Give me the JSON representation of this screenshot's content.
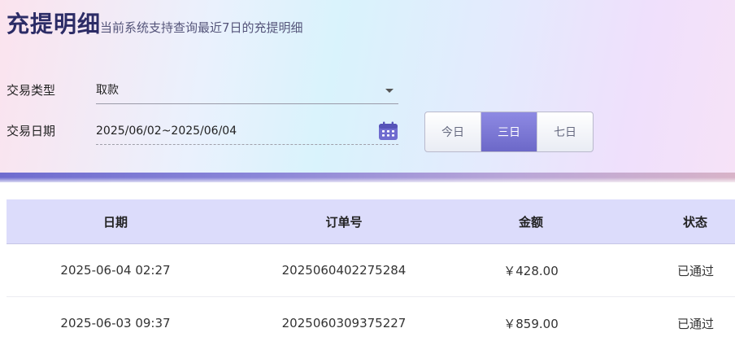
{
  "header": {
    "title": "充提明细",
    "subtitle": "当前系统支持查询最近7日的充提明细"
  },
  "filters": {
    "type_label": "交易类型",
    "type_value": "取款",
    "date_label": "交易日期",
    "date_value": "2025/06/02~2025/06/04",
    "ranges": [
      {
        "label": "今日",
        "active": false
      },
      {
        "label": "三日",
        "active": true
      },
      {
        "label": "七日",
        "active": false
      }
    ]
  },
  "table": {
    "headers": [
      "日期",
      "订单号",
      "金额",
      "状态"
    ],
    "rows": [
      {
        "date": "2025-06-04 02:27",
        "order": "2025060402275284",
        "amount": "￥428.00",
        "status": "已通过"
      },
      {
        "date": "2025-06-03 09:37",
        "order": "2025060309375227",
        "amount": "￥859.00",
        "status": "已通过"
      }
    ]
  },
  "colors": {
    "accent": "#6c68c8",
    "title": "#2c2c66",
    "table_header_bg": "#dcdcfb"
  },
  "icons": {
    "type_dropdown": "caret-down-icon",
    "date_picker": "calendar-icon"
  }
}
